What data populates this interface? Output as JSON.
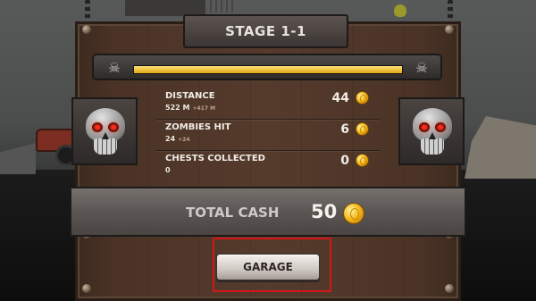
{
  "stage": {
    "title": "STAGE 1-1"
  },
  "progress": {
    "fraction": 1.0,
    "start_icon": "skull-icon",
    "end_icon": "skull-icon",
    "fill_color": "#f0c437"
  },
  "stats": [
    {
      "label": "DISTANCE",
      "sub_value": "522 M",
      "sub_gain": "+417 M",
      "reward": "44",
      "icon": "coin-icon"
    },
    {
      "label": "ZOMBIES HIT",
      "sub_value": "24",
      "sub_gain": "+24",
      "reward": "6",
      "icon": "coin-icon"
    },
    {
      "label": "CHESTS COLLECTED",
      "sub_value": "0",
      "sub_gain": "",
      "reward": "0",
      "icon": "coin-icon"
    }
  ],
  "total": {
    "label": "TOTAL CASH",
    "value": "50",
    "icon": "coin-icon"
  },
  "garage_button": {
    "label": "GARAGE",
    "highlight_color": "#d4161a"
  },
  "decor": {
    "left_plate_icon": "skull-icon",
    "right_plate_icon": "skull-icon"
  }
}
